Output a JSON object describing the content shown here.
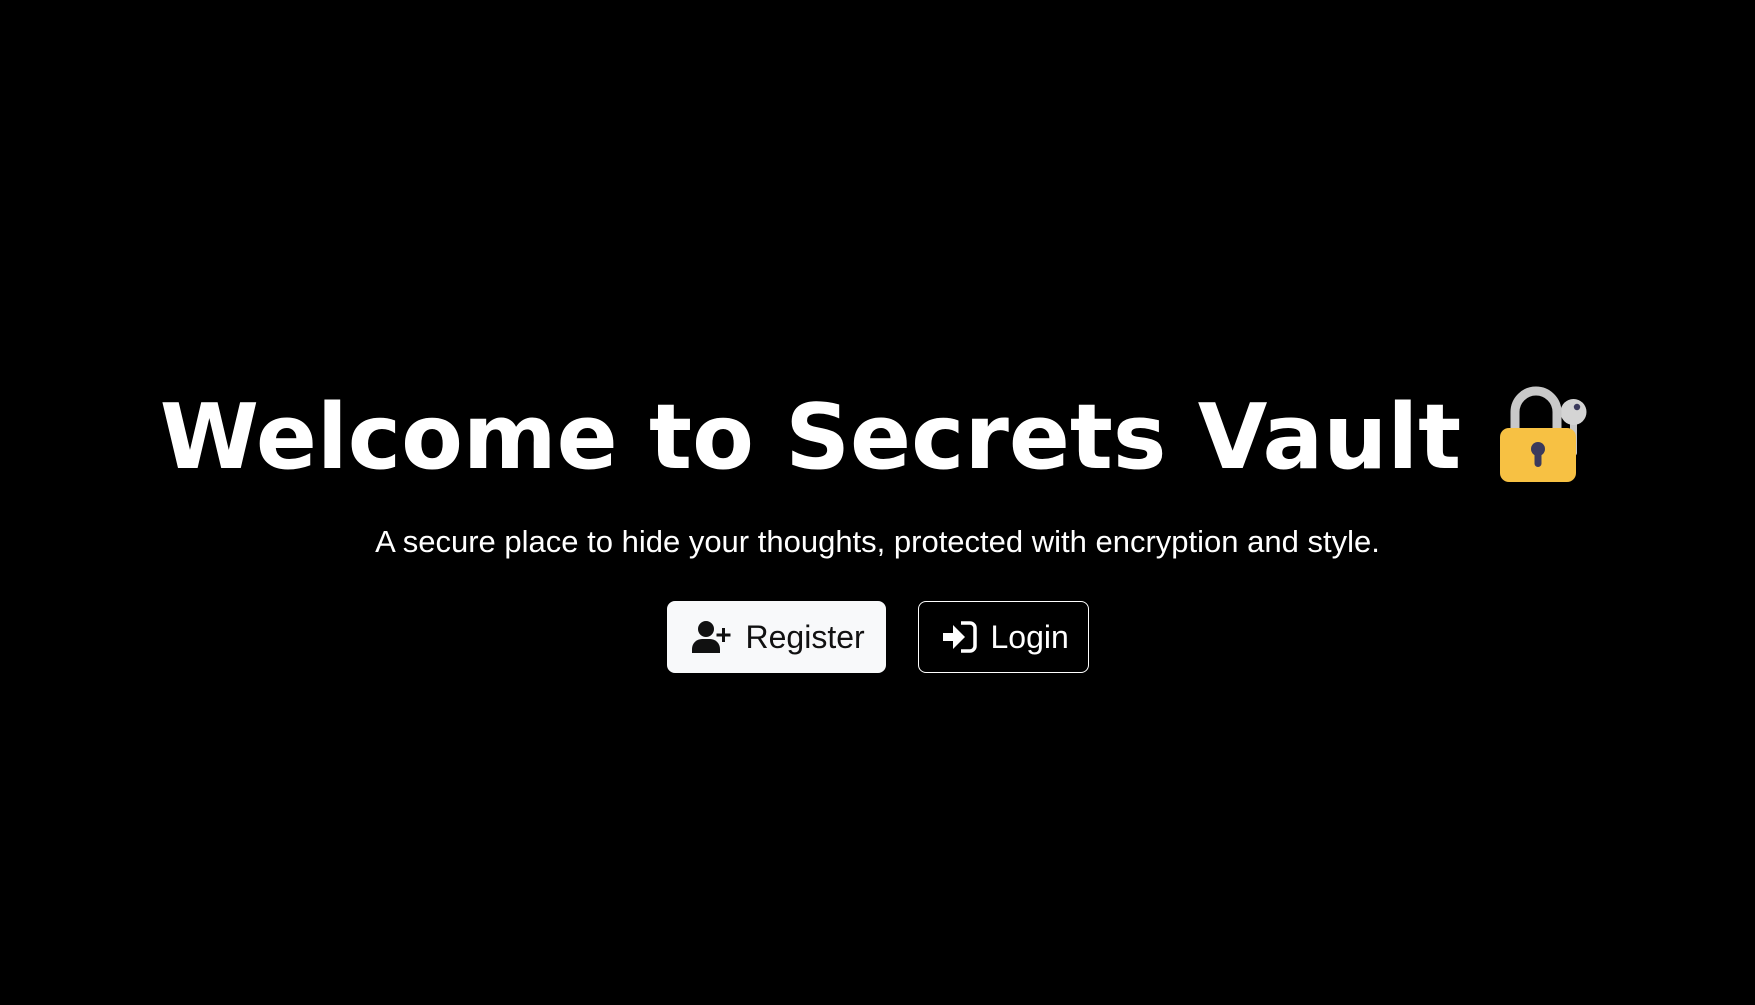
{
  "hero": {
    "title": "Welcome to Secrets Vault",
    "title_icon": "locked-with-key-icon",
    "subtitle": "A secure place to hide your thoughts, protected with encryption and style."
  },
  "actions": {
    "register": {
      "label": "Register",
      "icon": "user-plus-icon"
    },
    "login": {
      "label": "Login",
      "icon": "sign-in-icon"
    }
  },
  "colors": {
    "background": "#000000",
    "text": "#ffffff",
    "register_bg": "#f8f9fa",
    "login_border": "#ffffff",
    "lock_body": "#f7c143",
    "lock_shackle": "#c8c8c8",
    "keyhole": "#3b3a5c"
  }
}
